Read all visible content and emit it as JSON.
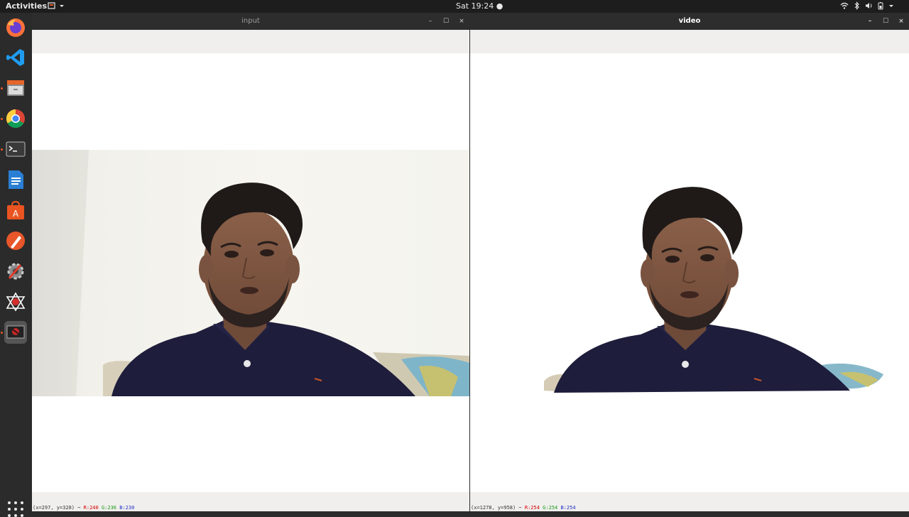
{
  "topbar": {
    "activities": "Activities",
    "clock": "Sat 19:24 ●",
    "tray_icons": [
      "wifi-icon",
      "bluetooth-icon",
      "volume-icon",
      "battery-icon",
      "chevron-down-icon"
    ]
  },
  "dock": {
    "items": [
      {
        "name": "firefox-icon",
        "running": false
      },
      {
        "name": "vscode-icon",
        "running": false
      },
      {
        "name": "files-icon",
        "running": true
      },
      {
        "name": "chrome-icon",
        "running": true
      },
      {
        "name": "terminal-icon",
        "running": true
      },
      {
        "name": "writer-icon",
        "running": false
      },
      {
        "name": "software-icon",
        "running": false
      },
      {
        "name": "inkscape-icon",
        "running": false
      },
      {
        "name": "tools-icon",
        "running": false
      },
      {
        "name": "network-icon",
        "running": false
      },
      {
        "name": "camera-app-icon",
        "running": true,
        "active": true
      }
    ]
  },
  "windows": {
    "input": {
      "title": "input",
      "status": {
        "coords": "(x=297, y=328) ~",
        "r": "R:240",
        "g": "G:236",
        "b": "B:230"
      }
    },
    "video": {
      "title": "video",
      "status": {
        "coords": "(x=1278, y=958) ~",
        "r": "R:254",
        "g": "G:254",
        "b": "B:254"
      }
    },
    "buttons": {
      "minimize": "–",
      "maximize": "☐",
      "close": "×"
    }
  },
  "colors": {
    "topbar": "#1d1d1d",
    "dock": "#2b2b2b",
    "accent": "#e95420",
    "shirt": "#1e1d3b"
  }
}
